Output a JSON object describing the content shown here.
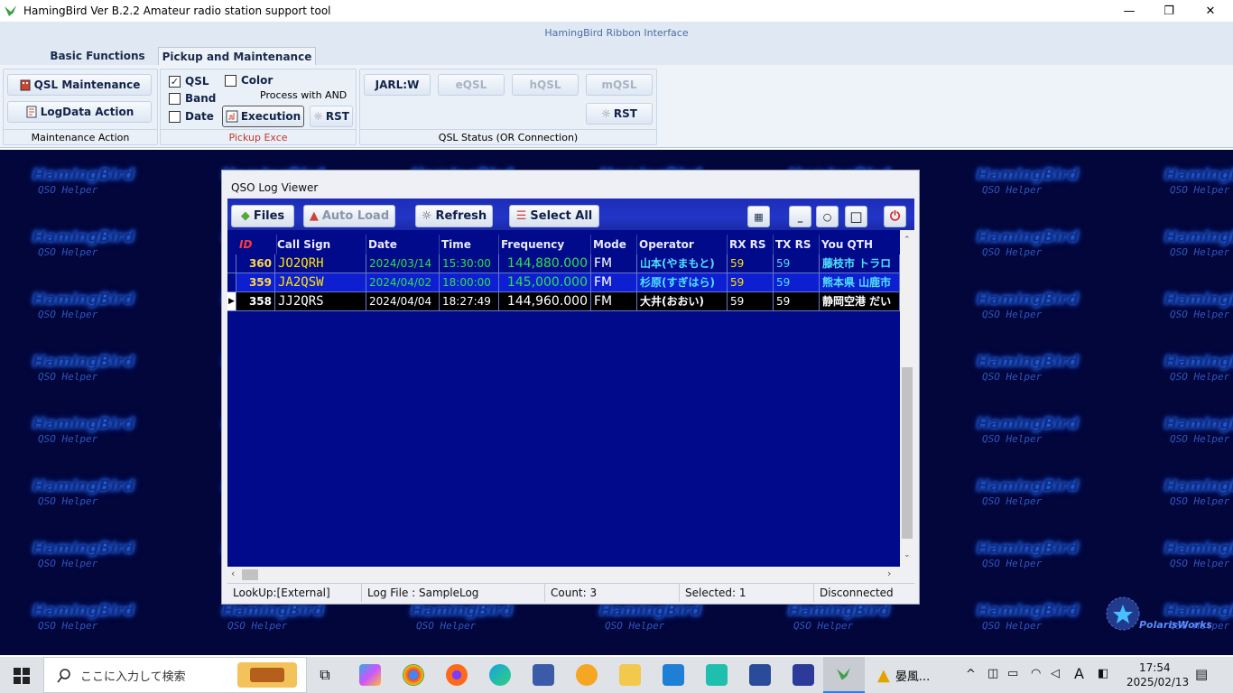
{
  "window": {
    "title": "HamingBird Ver B.2.2   Amateur radio station support tool",
    "minimize": "—",
    "restore": "❐",
    "close": "✕"
  },
  "ribbon": {
    "header": "HamingBird Ribbon Interface",
    "tabs": [
      {
        "label": "Basic Functions"
      },
      {
        "label": "Pickup and Maintenance"
      }
    ],
    "maintenance": {
      "qsl_button": "QSL Maintenance",
      "logdata_button": "LogData Action",
      "caption": "Maintenance Action"
    },
    "pickup": {
      "qsl": "QSL",
      "qsl_checked": true,
      "color": "Color",
      "color_checked": false,
      "band": "Band",
      "band_checked": false,
      "date": "Date",
      "date_checked": false,
      "process_label": "Process with AND",
      "execution_button": "Execution",
      "rst_button": "RST",
      "caption": "Pickup Exce"
    },
    "qsl_status": {
      "jarl": "JARL:W",
      "eqsl": "eQSL",
      "hqsl": "hQSL",
      "mqsl": "mQSL",
      "rst": "RST",
      "caption": "QSL Status (OR Connection)"
    }
  },
  "watermark": {
    "line1": "HamingBird",
    "line2": "QSO Helper",
    "brand": "PolarisWorks"
  },
  "qso": {
    "title": "QSO Log Viewer",
    "toolbar": {
      "files": "Files",
      "auto_load": "Auto Load",
      "refresh": "Refresh",
      "select_all": "Select All",
      "min": "_",
      "circle": "○",
      "square": "□"
    },
    "columns": [
      "ID",
      "Call Sign",
      "Date",
      "Time",
      "Frequency",
      "Mode",
      "Operator",
      "RX RS",
      "TX RS",
      "You QTH"
    ],
    "rows": [
      {
        "id": "360",
        "call": "JO2QRH",
        "date": "2024/03/14",
        "time": "15:30:00",
        "freq": "144,880.000",
        "mode": "FM",
        "op": "山本(やまもと)",
        "rx": "59",
        "tx": "59",
        "qth": "藤枝市 トラロ"
      },
      {
        "id": "359",
        "call": "JA2QSW",
        "date": "2024/04/02",
        "time": "18:00:00",
        "freq": "145,000.000",
        "mode": "FM",
        "op": "杉原(すぎはら)",
        "rx": "59",
        "tx": "59",
        "qth": "熊本県 山鹿市"
      },
      {
        "id": "358",
        "call": "JJ2QRS",
        "date": "2024/04/04",
        "time": "18:27:49",
        "freq": "144,960.000",
        "mode": "FM",
        "op": "大井(おおい)",
        "rx": "59",
        "tx": "59",
        "qth": "静岡空港 だい"
      }
    ],
    "status": {
      "lookup": "LookUp:[External]",
      "logfile": "Log File : SampleLog",
      "count": "Count: 3",
      "selected": "Selected: 1",
      "conn": "Disconnected"
    }
  },
  "taskbar": {
    "search_placeholder": "ここに入力して検索",
    "running_app": "晏風...",
    "time": "17:54",
    "date": "2025/02/13",
    "ime": "A"
  }
}
